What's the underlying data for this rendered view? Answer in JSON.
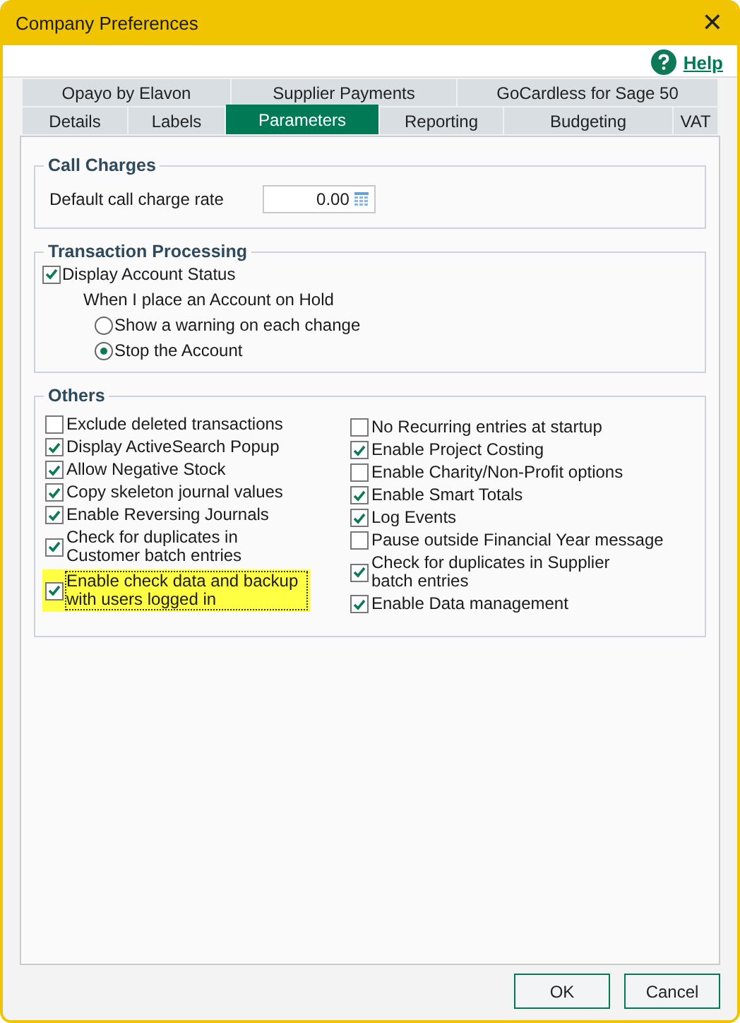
{
  "window": {
    "title": "Company Preferences",
    "close": "✕"
  },
  "help": {
    "label": "Help"
  },
  "tab_rows": [
    [
      {
        "label": "Opayo by Elavon",
        "selected": false
      },
      {
        "label": "Supplier Payments",
        "selected": false
      },
      {
        "label": "GoCardless for Sage 50",
        "selected": false
      }
    ],
    [
      {
        "label": "Details",
        "selected": false
      },
      {
        "label": "Labels",
        "selected": false
      },
      {
        "label": "Parameters",
        "selected": true
      },
      {
        "label": "Reporting",
        "selected": false
      },
      {
        "label": "Budgeting",
        "selected": false
      },
      {
        "label": "VAT",
        "selected": false
      }
    ]
  ],
  "call_charges": {
    "title": "Call Charges",
    "label": "Default call charge rate",
    "value": "0.00"
  },
  "transaction_processing": {
    "title": "Transaction Processing",
    "display_account_status": {
      "label": "Display Account Status",
      "checked": true
    },
    "hold_label": "When I place an Account on Hold",
    "options": [
      {
        "label": "Show a warning on each change",
        "selected": false
      },
      {
        "label": "Stop the Account",
        "selected": true
      }
    ]
  },
  "others": {
    "title": "Others",
    "left": [
      {
        "label": "Exclude deleted transactions",
        "checked": false,
        "highlighted": false
      },
      {
        "label": "Display ActiveSearch Popup",
        "checked": true,
        "highlighted": false
      },
      {
        "label": "Allow Negative Stock",
        "checked": true,
        "highlighted": false
      },
      {
        "label": "Copy skeleton journal values",
        "checked": true,
        "highlighted": false
      },
      {
        "label": "Enable Reversing Journals",
        "checked": true,
        "highlighted": false
      },
      {
        "label": "Check for duplicates in Customer batch entries",
        "checked": true,
        "highlighted": false
      },
      {
        "label": "Enable check data and backup with users logged in",
        "checked": true,
        "highlighted": true
      }
    ],
    "right": [
      {
        "label": "No Recurring entries at startup",
        "checked": false,
        "highlighted": false
      },
      {
        "label": "Enable Project Costing",
        "checked": true,
        "highlighted": false
      },
      {
        "label": "Enable Charity/Non-Profit options",
        "checked": false,
        "highlighted": false
      },
      {
        "label": "Enable Smart Totals",
        "checked": true,
        "highlighted": false
      },
      {
        "label": "Log Events",
        "checked": true,
        "highlighted": false
      },
      {
        "label": "Pause outside Financial Year message",
        "checked": false,
        "highlighted": false
      },
      {
        "label": "Check for duplicates in Supplier batch entries",
        "checked": true,
        "highlighted": false
      },
      {
        "label": "Enable Data management",
        "checked": true,
        "highlighted": false
      }
    ]
  },
  "buttons": [
    "OK",
    "Cancel"
  ]
}
